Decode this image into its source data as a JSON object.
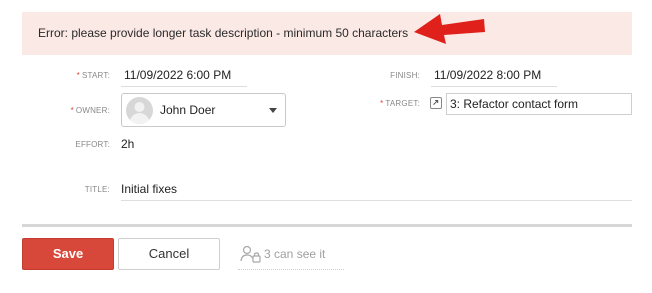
{
  "error": {
    "message": "Error: please provide longer task description - minimum 50 characters",
    "annotation_color": "#e0201a"
  },
  "form": {
    "start": {
      "label": "START:",
      "required": "*",
      "value": "11/09/2022 6:00 PM"
    },
    "finish": {
      "label": "FINISH:",
      "value": "11/09/2022 8:00 PM"
    },
    "owner": {
      "label": "OWNER:",
      "required": "*",
      "value": "John Doer"
    },
    "target": {
      "label": "TARGET:",
      "required": "*",
      "value": "3: Refactor contact form"
    },
    "effort": {
      "label": "EFFORT:",
      "value": "2h"
    },
    "title": {
      "label": "TITLE:",
      "value": "Initial fixes"
    }
  },
  "footer": {
    "save_label": "Save",
    "cancel_label": "Cancel",
    "visibility_text": "3 can see it"
  },
  "icons": {
    "owner_avatar": "user-avatar-icon",
    "target_link": "external-link-icon",
    "owner_dropdown": "chevron-down-icon",
    "visibility": "users-lock-icon",
    "annotation": "red-arrow-icon"
  },
  "colors": {
    "error_bg": "#fbe9e5",
    "save_bg": "#d8483a",
    "required": "#e0463a"
  }
}
